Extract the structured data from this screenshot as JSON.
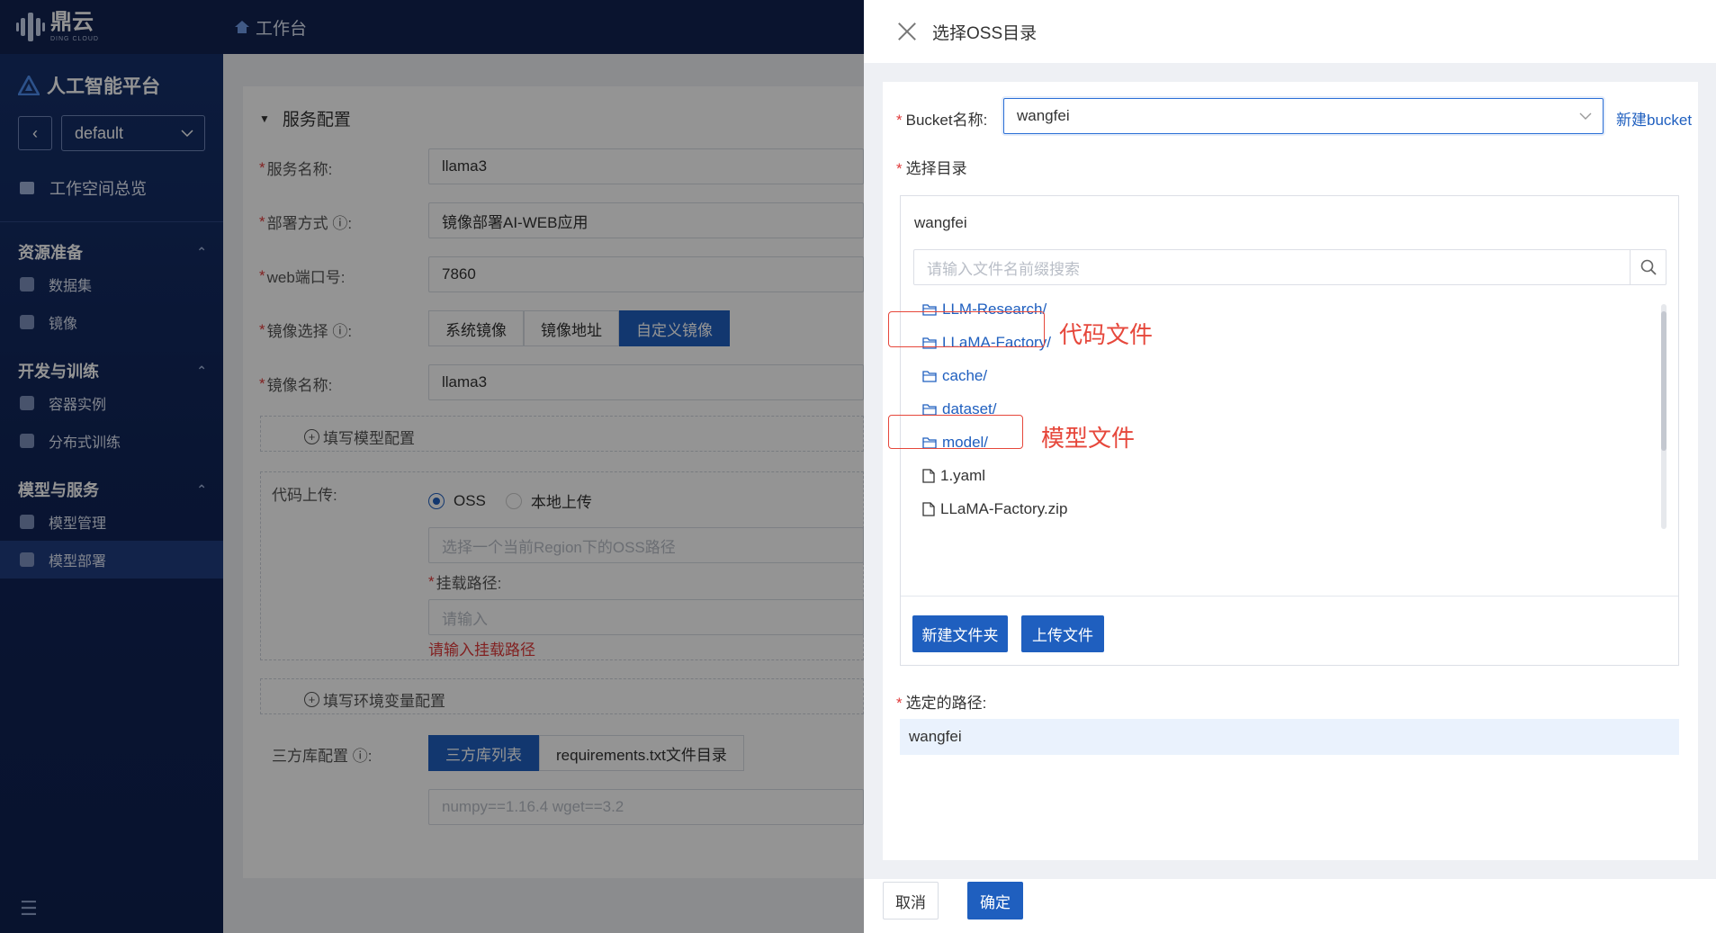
{
  "brand": {
    "logo_cn": "鼎云",
    "logo_en": "DING CLOUD",
    "workbench": "工作台"
  },
  "sidebar": {
    "platform": "人工智能平台",
    "workspace": "default",
    "overview": "工作空间总览",
    "groups": [
      {
        "title": "资源准备",
        "items": [
          "数据集",
          "镜像"
        ]
      },
      {
        "title": "开发与训练",
        "items": [
          "容器实例",
          "分布式训练"
        ]
      },
      {
        "title": "模型与服务",
        "items": [
          "模型管理",
          "模型部署"
        ]
      }
    ]
  },
  "form": {
    "section_title": "服务配置",
    "service_name_label": "服务名称:",
    "service_name": "llama3",
    "deploy_mode_label": "部署方式 ⓘ:",
    "deploy_mode": "镜像部署AI-WEB应用",
    "port_label": "web端口号:",
    "port": "7860",
    "image_select_label": "镜像选择 ⓘ:",
    "image_options": [
      "系统镜像",
      "镜像地址",
      "自定义镜像"
    ],
    "image_name_label": "镜像名称:",
    "image_name": "llama3",
    "add_model_config": "填写模型配置",
    "code_upload_label": "代码上传:",
    "code_options": [
      "OSS",
      "本地上传"
    ],
    "oss_path_placeholder": "选择一个当前Region下的OSS路径",
    "mount_label": "挂载路径:",
    "mount_placeholder": "请输入",
    "mount_error": "请输入挂载路径",
    "add_env_config": "填写环境变量配置",
    "third_party_label": "三方库配置 ⓘ:",
    "third_party_options": [
      "三方库列表",
      "requirements.txt文件目录"
    ],
    "third_party_placeholder": "numpy==1.16.4 wget==3.2"
  },
  "drawer": {
    "title": "选择OSS目录",
    "bucket_label": "Bucket名称:",
    "bucket_value": "wangfei",
    "new_bucket": "新建bucket",
    "dir_label": "选择目录",
    "tree_root": "wangfei",
    "search_placeholder": "请输入文件名前缀搜索",
    "files": [
      {
        "name": "LLM-Research/",
        "type": "folder"
      },
      {
        "name": "LLaMA-Factory/",
        "type": "folder"
      },
      {
        "name": "cache/",
        "type": "folder"
      },
      {
        "name": "dataset/",
        "type": "folder"
      },
      {
        "name": "model/",
        "type": "folder"
      },
      {
        "name": "1.yaml",
        "type": "file"
      },
      {
        "name": "LLaMA-Factory.zip",
        "type": "file"
      }
    ],
    "new_folder_btn": "新建文件夹",
    "upload_btn": "上传文件",
    "annotation_code": "代码文件",
    "annotation_model": "模型文件",
    "selected_path_label": "选定的路径:",
    "selected_path": "wangfei",
    "cancel_btn": "取消",
    "confirm_btn": "确定"
  },
  "colors": {
    "primary": "#1f5fbf",
    "annotation_red": "#e6473b",
    "sidebar_bg": "#112558"
  }
}
